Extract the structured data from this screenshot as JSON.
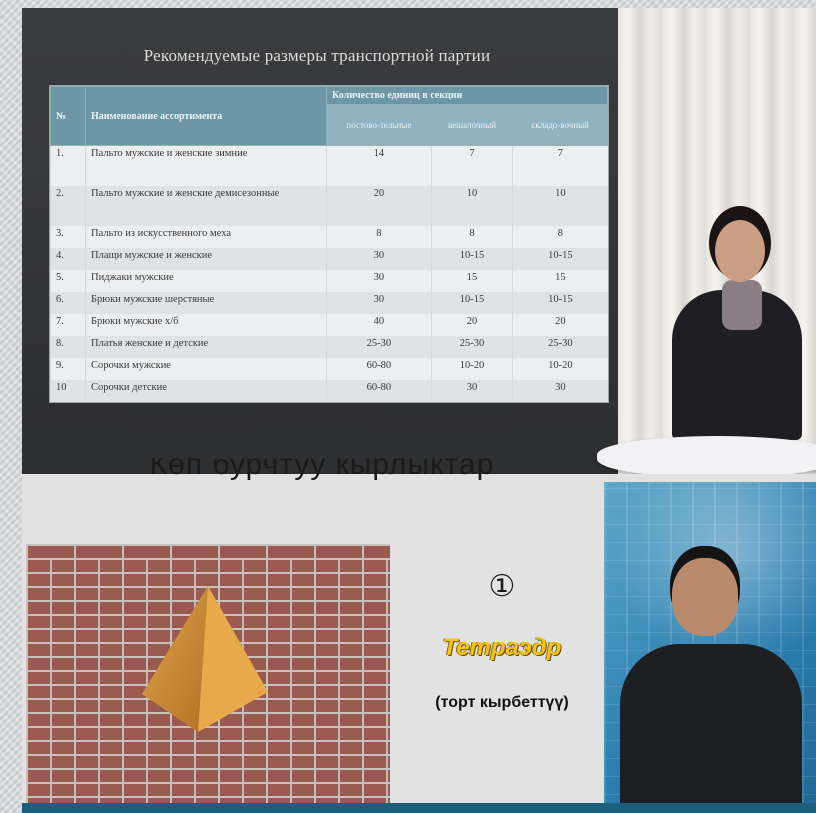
{
  "top_slide": {
    "title": "Рекомендуемые размеры транспортной партии",
    "table": {
      "col_no": "№",
      "col_name": "Наименование ассортимента",
      "col_qty": "Количество единиц в секции",
      "sub_cols": [
        "постово-тельные",
        "вешалочный",
        "складо-вочный"
      ],
      "rows": [
        {
          "no": "1.",
          "name": "Пальто мужские и женские зимние",
          "a": "14",
          "b": "7",
          "c": "7"
        },
        {
          "no": "2.",
          "name": "Пальто мужские и женские демисезонные",
          "a": "20",
          "b": "10",
          "c": "10"
        },
        {
          "no": "3.",
          "name": "Пальто из искусственного меха",
          "a": "8",
          "b": "8",
          "c": "8"
        },
        {
          "no": "4.",
          "name": "Плащи мужские и женские",
          "a": "30",
          "b": "10-15",
          "c": "10-15"
        },
        {
          "no": "5.",
          "name": "Пиджаки мужские",
          "a": "30",
          "b": "15",
          "c": "15"
        },
        {
          "no": "6.",
          "name": "Брюки мужские шерстяные",
          "a": "30",
          "b": "10-15",
          "c": "10-15"
        },
        {
          "no": "7.",
          "name": "Брюки мужские х/б",
          "a": "40",
          "b": "20",
          "c": "20"
        },
        {
          "no": "8.",
          "name": "Платья женские и детские",
          "a": "25-30",
          "b": "25-30",
          "c": "25-30"
        },
        {
          "no": "9.",
          "name": "Сорочки мужские",
          "a": "60-80",
          "b": "10-20",
          "c": "10-20"
        },
        {
          "no": "10",
          "name": "Сорочки детские",
          "a": "60-80",
          "b": "30",
          "c": "30"
        }
      ]
    }
  },
  "bottom_slide": {
    "heading": "Көп бурчтуу кырлыктар",
    "number_symbol": "①",
    "shape_name": "Тетраэдр",
    "shape_subtitle": "(торт кырбеттүү)"
  },
  "colors": {
    "table_header": "#6d97a6",
    "label_yellow": "#f0c419",
    "brick": "#9a5a4f"
  }
}
